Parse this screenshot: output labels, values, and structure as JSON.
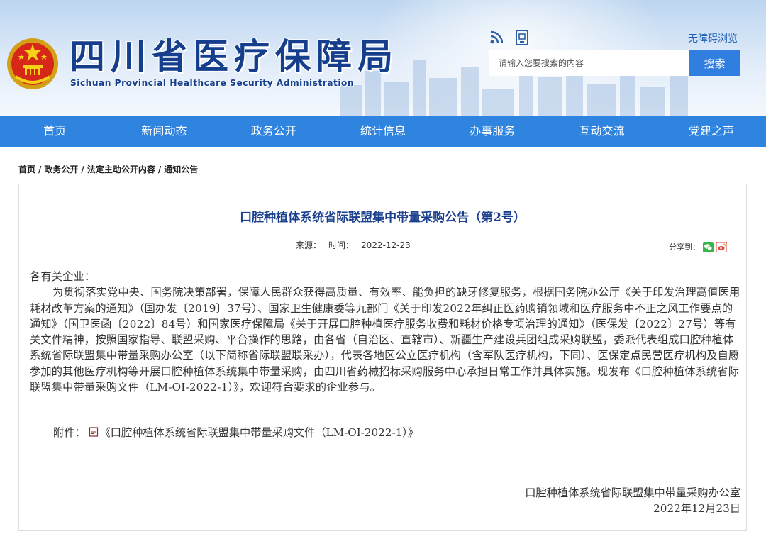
{
  "header": {
    "title_cn": "四川省医疗保障局",
    "title_en": "Sichuan Provincial Healthcare Security Administration",
    "accessibility_link": "无障碍浏览",
    "search": {
      "placeholder": "请输入您要搜索的内容",
      "button_label": "搜索"
    },
    "icons": [
      "rss-icon",
      "mobile-icon"
    ],
    "brand_color": "#153f8d"
  },
  "nav": {
    "items": [
      {
        "label": "首页"
      },
      {
        "label": "新闻动态"
      },
      {
        "label": "政务公开"
      },
      {
        "label": "统计信息"
      },
      {
        "label": "办事服务"
      },
      {
        "label": "互动交流"
      },
      {
        "label": "党建之声"
      }
    ],
    "color": "#2f84e0"
  },
  "breadcrumb": [
    "首页",
    "政务公开",
    "法定主动公开内容",
    "通知公告"
  ],
  "article": {
    "title": "口腔种植体系统省际联盟集中带量采购公告（第2号）",
    "source_label": "来源：",
    "time_label": "时间：",
    "time_value": "2022-12-23",
    "share_label": "分享到：",
    "share_icons": [
      "wechat-icon",
      "weibo-icon"
    ],
    "salutation": "各有关企业：",
    "paragraph": "为贯彻落实党中央、国务院决策部署，保障人民群众获得高质量、有效率、能负担的缺牙修复服务，根据国务院办公厅《关于印发治理高值医用耗材改革方案的通知》（国办发〔2019〕37号）、国家卫生健康委等九部门《关于印发2022年纠正医药购销领域和医疗服务中不正之风工作要点的通知》（国卫医函〔2022〕84号）和国家医疗保障局《关于开展口腔种植医疗服务收费和耗材价格专项治理的通知》（医保发〔2022〕27号）等有关文件精神，按照国家指导、联盟采购、平台操作的思路，由各省（自治区、直辖市）、新疆生产建设兵团组成采购联盟，委派代表组成口腔种植体系统省际联盟集中带量采购办公室（以下简称省际联盟联采办），代表各地区公立医疗机构（含军队医疗机构，下同）、医保定点民营医疗机构及自愿参加的其他医疗机构等开展口腔种植体系统集中带量采购，由四川省药械招标采购服务中心承担日常工作并具体实施。现发布《口腔种植体系统省际联盟集中带量采购文件（LM-OI-2022-1）》，欢迎符合要求的企业参与。",
    "attachment_label": "附件：",
    "attachment_link": "《口腔种植体系统省际联盟集中带量采购文件（LM-OI-2022-1）》",
    "signature": "口腔种植体系统省际联盟集中带量采购办公室",
    "sign_date": "2022年12月23日",
    "title_color": "#1a3f8f"
  }
}
